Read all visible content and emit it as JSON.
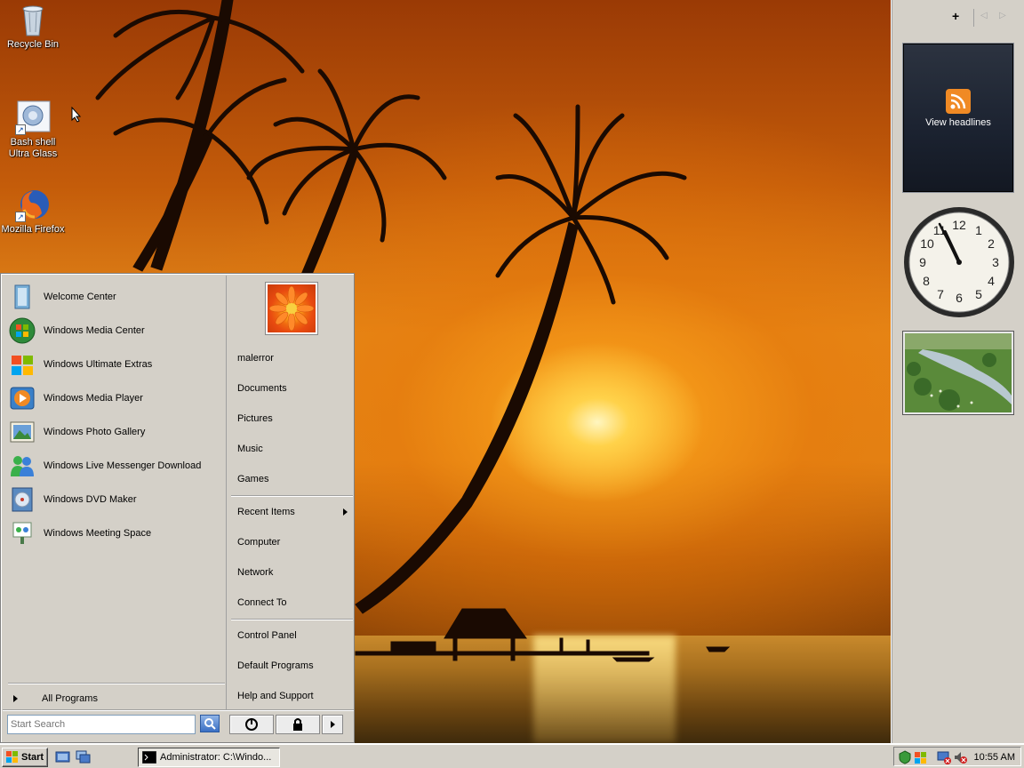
{
  "desktop": {
    "icons": [
      {
        "label": "Recycle Bin"
      },
      {
        "label": "Bash shell Ultra Glass"
      },
      {
        "label": "Mozilla Firefox"
      }
    ]
  },
  "start_menu": {
    "programs": [
      {
        "label": "Welcome Center"
      },
      {
        "label": "Windows Media Center"
      },
      {
        "label": "Windows Ultimate Extras"
      },
      {
        "label": "Windows Media Player"
      },
      {
        "label": "Windows Photo Gallery"
      },
      {
        "label": "Windows Live Messenger Download"
      },
      {
        "label": "Windows DVD Maker"
      },
      {
        "label": "Windows Meeting Space"
      }
    ],
    "all_programs": "All Programs",
    "search_placeholder": "Start Search",
    "user_name": "malerror",
    "places": [
      {
        "label": "Documents"
      },
      {
        "label": "Pictures"
      },
      {
        "label": "Music"
      },
      {
        "label": "Games"
      }
    ],
    "system": [
      {
        "label": "Recent Items"
      },
      {
        "label": "Computer"
      },
      {
        "label": "Network"
      },
      {
        "label": "Connect To"
      }
    ],
    "settings": [
      {
        "label": "Control Panel"
      },
      {
        "label": "Default Programs"
      },
      {
        "label": "Help and Support"
      }
    ]
  },
  "sidebar": {
    "add_symbol": "+",
    "prev_symbol": "◁",
    "next_symbol": "▷",
    "feed_gadget_label": "View headlines",
    "clock_numbers": [
      "12",
      "1",
      "2",
      "3",
      "4",
      "5",
      "6",
      "7",
      "8",
      "9",
      "10",
      "11"
    ]
  },
  "taskbar": {
    "start_label": "Start",
    "task_window": "Administrator: C:\\Windo...",
    "time": "10:55 AM"
  },
  "colors": {
    "rss_orange": "#f08a24",
    "accent_blue": "#3a6fc4"
  }
}
